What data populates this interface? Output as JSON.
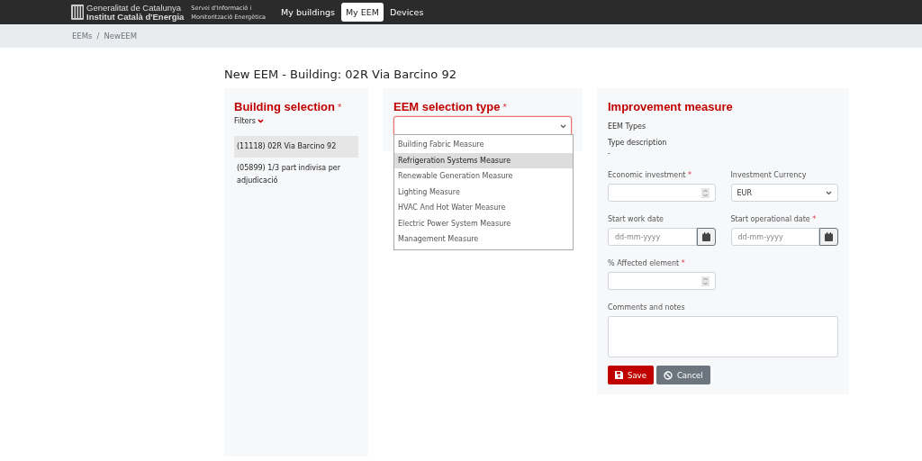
{
  "navbar": {
    "brand_lines": [
      "Generalitat de Catalunya",
      "Institut Català d'Energia"
    ],
    "service_lines": [
      "Servei d'Informació i",
      "Monitorització Energètica"
    ],
    "items": [
      {
        "label": "My buildings",
        "selected": false
      },
      {
        "label": "My EEM",
        "selected": true
      },
      {
        "label": "Devices",
        "selected": false
      }
    ]
  },
  "breadcrumb": [
    "EEMs",
    "/",
    "NewEEM"
  ],
  "page_title": "New EEM - Building: 02R Via Barcino 92",
  "building_selection": {
    "heading": "Building selection",
    "required_mark": "*",
    "filters": "Filters",
    "buildings": [
      {
        "label": "(11118) 02R Via Barcino 92",
        "selected": true
      },
      {
        "label": "(05899) 1/3 part indivisa per adjudicació",
        "selected": false
      }
    ]
  },
  "eem_selection": {
    "heading": "EEM selection type",
    "required_mark": "*",
    "expanded": true,
    "options": [
      {
        "label": "Building Fabric Measure",
        "selected": false
      },
      {
        "label": "Refrigeration Systems Measure",
        "selected": true
      },
      {
        "label": "Renewable Generation Measure",
        "selected": false
      },
      {
        "label": "Lighting Measure",
        "selected": false
      },
      {
        "label": "HVAC And Hot Water Measure",
        "selected": false
      },
      {
        "label": "Electric Power System Measure",
        "selected": false
      },
      {
        "label": "Management Measure",
        "selected": false
      }
    ]
  },
  "improvement_measure": {
    "heading": "Improvement measure",
    "eem_types_label": "EEM Types",
    "type_description_label": "Type description",
    "type_description": "-",
    "field_rows": [
      [
        {
          "kind": "number",
          "label": "Economic investment",
          "required_mark": "*"
        },
        {
          "kind": "select",
          "label": "Investment Currency",
          "value": "EUR"
        }
      ],
      [
        {
          "kind": "date",
          "label": "Start work date",
          "placeholder": "dd-mm-yyyy"
        },
        {
          "kind": "date",
          "label": "Start operational date",
          "required_mark": "*",
          "placeholder": "dd-mm-yyyy"
        }
      ],
      [
        {
          "kind": "number",
          "label": "% Affected element",
          "required_mark": "*"
        }
      ],
      [
        {
          "kind": "textarea",
          "label": "Comments and notes"
        }
      ]
    ],
    "buttons": [
      {
        "kind": "save",
        "label": "Save"
      },
      {
        "kind": "cancel",
        "label": "Cancel"
      }
    ]
  }
}
